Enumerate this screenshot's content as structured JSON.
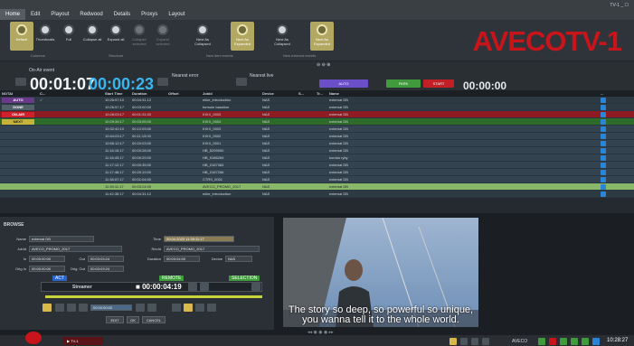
{
  "window_title": "TV-1 _ ☐",
  "menu": [
    "Home",
    "Edit",
    "Playout",
    "Redwood",
    "Details",
    "Proxys",
    "Layout"
  ],
  "ribbon": {
    "buttons": [
      "Default",
      "Thumbnails",
      "Full",
      "Collapse all",
      "Expand all",
      "Collapse selected",
      "Expand selected",
      "Next As Collapsed",
      "Next As Expanded",
      "Next As Collapsed",
      "Next As Expanded"
    ],
    "groups": [
      "Columns",
      "Structure",
      "New item events",
      "New external events"
    ]
  },
  "logo": {
    "a": "AVECO",
    "b": "TV-1"
  },
  "status": {
    "onair_label": "On-Air event",
    "onair_time": "00:01:07",
    "remaining_time": "00:00:23",
    "nearest_error_label": "Nearest error",
    "nearest_live_label": "Nearest live",
    "auto_label": "AUTO",
    "park_label": "PARK",
    "start_label": "START",
    "countdown": "00:00:00"
  },
  "playlist": {
    "columns": [
      "NOTAI",
      "C...",
      "Start Time",
      "Duration",
      "Offset",
      "Jobid",
      "Device",
      "S...",
      "Tr...",
      "Name",
      "..."
    ],
    "rows": [
      {
        "status": "AUTO",
        "tag": "auto",
        "check": "✓",
        "start": "10:26:57:10",
        "dur": "00:04:31:12",
        "job": "mike_introduction",
        "dev": "NAS",
        "name": "external DB",
        "cls": "dim"
      },
      {
        "status": "DONE",
        "tag": "gray",
        "check": "",
        "start": "10:26:57:17",
        "dur": "00:03:00:00",
        "job": "formule baseline",
        "dev": "NAS",
        "name": "external DB",
        "cls": "dim"
      },
      {
        "status": "ON-AIR",
        "tag": "onair",
        "check": "",
        "start": "10:28:03:17",
        "dur": "00:01:31:00",
        "job": "KIXX_0003",
        "dev": "NAS",
        "name": "external DB",
        "cls": "sel"
      },
      {
        "status": "NEXT",
        "tag": "next",
        "check": "",
        "start": "10:29:34:17",
        "dur": "00:03:05:00",
        "job": "KIXX_0004",
        "dev": "NAS",
        "name": "external DB",
        "cls": "next"
      },
      {
        "status": "",
        "tag": "",
        "check": "",
        "start": "10:32:42:10",
        "dur": "00:12:03:00",
        "job": "KIXX_0003",
        "dev": "NAS",
        "name": "external DB",
        "cls": ""
      },
      {
        "status": "",
        "tag": "",
        "check": "",
        "start": "10:44:03:17",
        "dur": "00:11:13:00",
        "job": "KIXX_0002",
        "dev": "NAS",
        "name": "external DB",
        "cls": ""
      },
      {
        "status": "",
        "tag": "",
        "check": "",
        "start": "10:56:12:17",
        "dur": "00:20:03:00",
        "job": "KIXX_0001",
        "dev": "NAS",
        "name": "external DB",
        "cls": ""
      },
      {
        "status": "",
        "tag": "",
        "check": "",
        "start": "11:16:15:17",
        "dur": "00:00:28:00",
        "job": "HB_5299900",
        "dev": "NAS",
        "name": "external DB",
        "cls": ""
      },
      {
        "status": "",
        "tag": "",
        "check": "",
        "start": "11:16:43:17",
        "dur": "00:00:29:00",
        "job": "HB_9186269",
        "dev": "NAS",
        "name": "kordos ryby",
        "cls": ""
      },
      {
        "status": "",
        "tag": "",
        "check": "",
        "start": "11:17:12:17",
        "dur": "00:00:35:00",
        "job": "HB_0187384",
        "dev": "NAS",
        "name": "external DB",
        "cls": ""
      },
      {
        "status": "",
        "tag": "",
        "check": "",
        "start": "11:17:48:17",
        "dur": "00:20:19:00",
        "job": "HB_0187266",
        "dev": "NAS",
        "name": "external DB",
        "cls": ""
      },
      {
        "status": "",
        "tag": "",
        "check": "",
        "start": "11:38:07:17",
        "dur": "00:01:04:00",
        "job": "CTRS_0001",
        "dev": "NAS",
        "name": "external DB",
        "cls": ""
      },
      {
        "status": "",
        "tag": "",
        "check": "",
        "start": "11:39:11:17",
        "dur": "00:03:24:00",
        "job": "AVECO_PROMO_2017",
        "dev": "NAS",
        "name": "external DB",
        "cls": "hilite"
      },
      {
        "status": "",
        "tag": "",
        "check": "",
        "start": "11:42:35:17",
        "dur": "00:04:31:12",
        "job": "mike_introduction",
        "dev": "NAS",
        "name": "external DB",
        "cls": "dim"
      }
    ]
  },
  "browse": {
    "title": "BROWSE",
    "name_label": "Name",
    "name_value": "external DB",
    "time_label": "Time",
    "time_value": "20.04.2023 11:39:11:17",
    "jobid_label": "JobId",
    "jobid_value": "AVECO_PROMO_2017",
    "recid_label": "RecId",
    "recid_value": "AVECO_PROMO_2017",
    "in_label": "In",
    "in_value": "00:00:00:00",
    "out_label": "Out",
    "out_value": "00:03:03:24",
    "duration_label": "Duration",
    "duration_value": "00:03:04:00",
    "device_label": "Device",
    "device_value": "NAS",
    "origin_label": "Orig In",
    "origin_value": "00:00:00:00",
    "origout_label": "Orig. Out",
    "origout_value": "00:03:03:24",
    "act_label": "ACT",
    "remote_label": "REMOTE",
    "selection_label": "SELECTION",
    "streamer_label": "Streamer",
    "player_time": "00:00:04:19",
    "small_time": "00:00:00:00",
    "edit_label": "EDIT",
    "ok_label": "OK",
    "cancel_label": "CANCEL"
  },
  "video": {
    "subtitle_1": "The story so deep, so powerful so unique,",
    "subtitle_2": "you wanna tell it to the whole world."
  },
  "footer": {
    "tab_label": "TV-1",
    "user": "AVECO",
    "clock": "10:28:27"
  },
  "colors": {
    "accent_red": "#c8141b",
    "onair_red": "#d0202b",
    "next_green": "#2e6b2b",
    "clock_blue": "#3ab5f0",
    "ribbon_gold": "#b3a862"
  }
}
